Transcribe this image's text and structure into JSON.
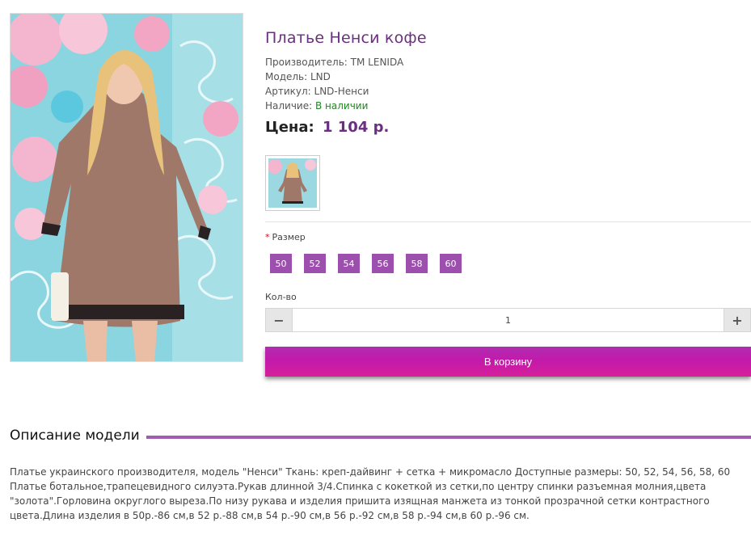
{
  "product": {
    "title": "Платье Ненси кофе",
    "specs": [
      {
        "label": "Производитель:",
        "value": "TM LENIDA"
      },
      {
        "label": "Модель:",
        "value": "LND"
      },
      {
        "label": "Артикул:",
        "value": "LND-Ненси"
      }
    ],
    "availability_label": "Наличие:",
    "availability_value": "В наличии",
    "price_label": "Цена:",
    "price_value": "1 104 р."
  },
  "options": {
    "size_required_mark": "*",
    "size_label": "Размер",
    "sizes": [
      "50",
      "52",
      "54",
      "56",
      "58",
      "60"
    ],
    "qty_label": "Кол-во",
    "qty_value": "1",
    "minus": "−",
    "plus": "+"
  },
  "cart": {
    "button_label": "В корзину"
  },
  "description": {
    "heading": "Описание модели",
    "text": "Платье украинского производителя, модель \"Ненси\" Ткань: креп-дайвинг + сетка + микромасло Доступные размеры: 50, 52, 54, 56, 58, 60 Платье ботальное,трапецевидного силуэта.Рукав длинной 3/4.Спинка с кокеткой из сетки,по центру спинки разъемная молния,цвета \"золота\".Горловина округлого выреза.По низу рукава и изделия пришита изящная манжета из тонкой прозрачной сетки контрастного цвета.Длина изделия в 50р.-86 см,в 52 р.-88 см,в 54 р.-90 см,в 56 р.-92 см,в 58 р.-94 см,в 60 р.-96 см."
  },
  "colors": {
    "accent_purple": "#6a2f7e",
    "size_button": "#9d4fad",
    "cart_button": "#c21aab",
    "availability_green": "#1c8a1c",
    "description_rule": "#a15bb0"
  }
}
